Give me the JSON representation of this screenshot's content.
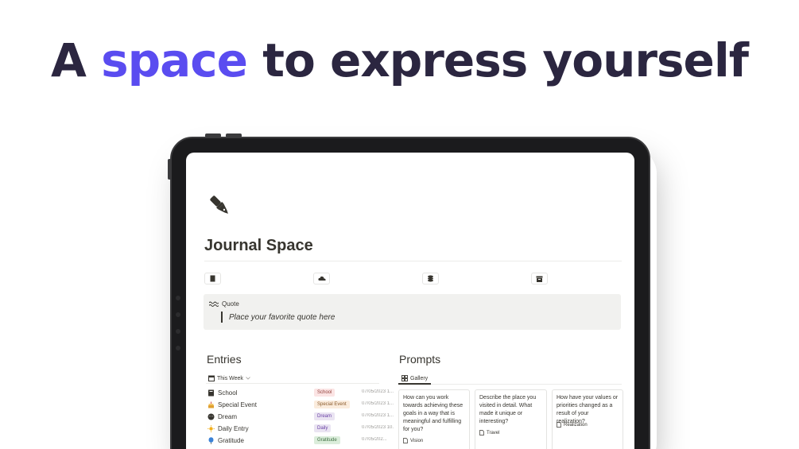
{
  "headline": {
    "part1": "A ",
    "accent": "space",
    "part2": " to express yourself"
  },
  "colors": {
    "accent": "#5a4cf0",
    "headline": "#2b2640",
    "callout_bg": "#f1f1ef"
  },
  "page": {
    "icon": "fountain-pen-icon",
    "title": "Journal Space"
  },
  "links": [
    {
      "icon": "page-icon"
    },
    {
      "icon": "cloud-icon"
    },
    {
      "icon": "stack-icon"
    },
    {
      "icon": "archive-icon"
    }
  ],
  "callout": {
    "icon": "waves-icon",
    "label": "Quote",
    "quote": "Place your favorite quote here"
  },
  "entries": {
    "title": "Entries",
    "view": "This Week",
    "rows": [
      {
        "icon": "book-icon",
        "name": "School",
        "tag": "School",
        "tag_bg": "#fbe4e4",
        "tag_fg": "#93413c",
        "date": "07/05/2023 1..."
      },
      {
        "icon": "cake-icon",
        "name": "Special Event",
        "tag": "Special Event",
        "tag_bg": "#fbecdd",
        "tag_fg": "#8a5a2b",
        "date": "07/05/2023 1..."
      },
      {
        "icon": "sleep-icon",
        "name": "Dream",
        "tag": "Dream",
        "tag_bg": "#eae4f2",
        "tag_fg": "#6940a5",
        "date": "07/05/2023 1..."
      },
      {
        "icon": "sun-icon",
        "name": "Daily Entry",
        "tag": "Daily",
        "tag_bg": "#eae4f2",
        "tag_fg": "#6940a5",
        "date": "07/05/2023 10..."
      },
      {
        "icon": "balloon-icon",
        "name": "Gratitude",
        "tag": "Gratitude",
        "tag_bg": "#dbeddb",
        "tag_fg": "#3f6f42",
        "date": "07/05/202..."
      }
    ]
  },
  "prompts": {
    "title": "Prompts",
    "view": "Gallery",
    "cards": [
      {
        "text": "How can you work towards achieving these goals in a way that is meaningful and fulfilling for you?",
        "tag": "Vision"
      },
      {
        "text": "Describe the place you visited in detail. What made it unique or interesting?",
        "tag": "Travel"
      },
      {
        "text": "How have your values or priorities changed as a result of your realization?",
        "tag": "Realization"
      }
    ]
  }
}
